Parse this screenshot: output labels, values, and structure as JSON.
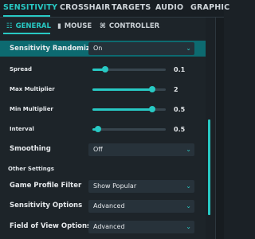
{
  "top_tabs": [
    "SENSITIVITY",
    "CROSSHAIR",
    "TARGETS",
    "AUDIO",
    "GRAPHIC"
  ],
  "sub_tabs": [
    {
      "label": "GENERAL",
      "icon": "sliders-icon"
    },
    {
      "label": "MOUSE",
      "icon": "mouse-icon"
    },
    {
      "label": "CONTROLLER",
      "icon": "gamepad-icon"
    }
  ],
  "randomizer": {
    "label": "Sensitivity Randomizer",
    "value": "On"
  },
  "sliders": [
    {
      "label": "Spread",
      "value": "0.1",
      "fraction": 0.17
    },
    {
      "label": "Max Multiplier",
      "value": "2",
      "fraction": 0.82
    },
    {
      "label": "Min Multiplier",
      "value": "0.5",
      "fraction": 0.82
    },
    {
      "label": "Interval",
      "value": "0.5",
      "fraction": 0.08
    }
  ],
  "smoothing": {
    "label": "Smoothing",
    "value": "Off"
  },
  "other_settings": {
    "title": "Other Settings",
    "items": [
      {
        "label": "Game Profile Filter",
        "value": "Show Popular"
      },
      {
        "label": "Sensitivity Options",
        "value": "Advanced"
      },
      {
        "label": "Field of View Options",
        "value": "Advanced"
      }
    ]
  },
  "colors": {
    "accent": "#28c9c4",
    "highlight_row": "#0d6a70"
  }
}
